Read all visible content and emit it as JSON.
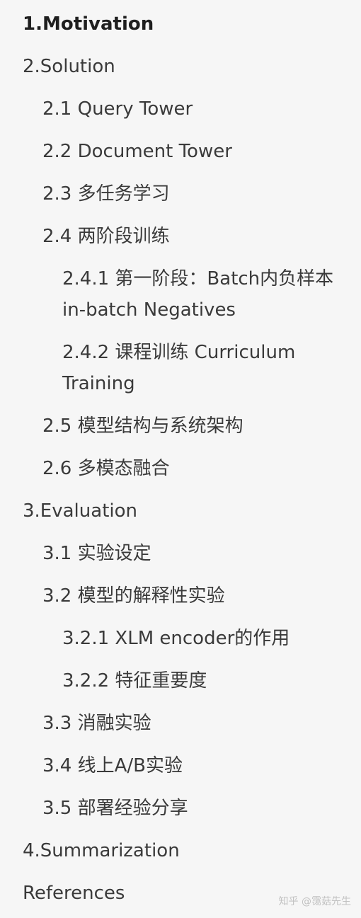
{
  "toc": {
    "items": [
      {
        "label": "1.Motivation"
      },
      {
        "label": "2.Solution"
      },
      {
        "label": "2.1 Query Tower"
      },
      {
        "label": "2.2 Document Tower"
      },
      {
        "label": "2.3 多任务学习"
      },
      {
        "label": "2.4 两阶段训练"
      },
      {
        "label": "2.4.1 第一阶段：Batch内负样本 in-batch Negatives"
      },
      {
        "label": "2.4.2 课程训练 Curriculum Training"
      },
      {
        "label": "2.5 模型结构与系统架构"
      },
      {
        "label": "2.6 多模态融合"
      },
      {
        "label": "3.Evaluation"
      },
      {
        "label": "3.1 实验设定"
      },
      {
        "label": "3.2 模型的解释性实验"
      },
      {
        "label": "3.2.1 XLM encoder的作用"
      },
      {
        "label": "3.2.2 特征重要度"
      },
      {
        "label": "3.3 消融实验"
      },
      {
        "label": "3.4 线上A/B实验"
      },
      {
        "label": "3.5 部署经验分享"
      },
      {
        "label": "4.Summarization"
      },
      {
        "label": "References"
      }
    ]
  },
  "watermark": {
    "text": "知乎 @霭菇先生"
  }
}
